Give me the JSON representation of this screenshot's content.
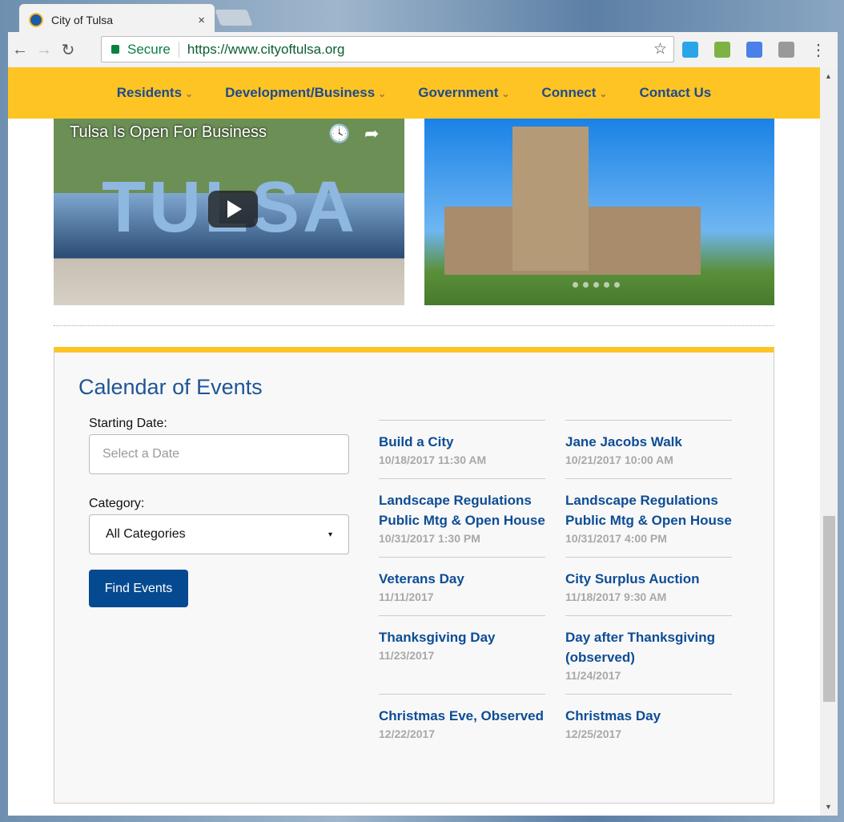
{
  "browser": {
    "tab_title": "City of Tulsa",
    "close": "×",
    "secure_label": "Secure",
    "url": "https://www.cityoftulsa.org",
    "back": "←",
    "forward": "→",
    "reload": "↻",
    "star": "☆",
    "menu": "⋮"
  },
  "nav": {
    "items": [
      {
        "label": "Residents",
        "dropdown": true
      },
      {
        "label": "Development/Business",
        "dropdown": true
      },
      {
        "label": "Government",
        "dropdown": true
      },
      {
        "label": "Connect",
        "dropdown": true
      },
      {
        "label": "Contact Us",
        "dropdown": false
      }
    ],
    "chevron": "❯",
    "bg": "#fdc424",
    "text_color": "#1f4a8c"
  },
  "video": {
    "title": "Tulsa Is Open For Business",
    "mural_text": "TULSA",
    "watch_later": "🕓",
    "share": "➦"
  },
  "calendar": {
    "title": "Calendar of Events",
    "starting_date_label": "Starting Date:",
    "date_placeholder": "Select a Date",
    "category_label": "Category:",
    "category_value": "All Categories",
    "caret": "▾",
    "find_button": "Find Events",
    "events": [
      {
        "title": "Build a City",
        "date": "10/18/2017 11:30 AM"
      },
      {
        "title": "Jane Jacobs Walk",
        "date": "10/21/2017 10:00 AM"
      },
      {
        "title": "Landscape Regulations Public Mtg & Open House",
        "date": "10/31/2017 1:30 PM"
      },
      {
        "title": "Landscape Regulations Public Mtg & Open House",
        "date": "10/31/2017 4:00 PM"
      },
      {
        "title": "Veterans Day",
        "date": "11/11/2017"
      },
      {
        "title": "City Surplus Auction",
        "date": "11/18/2017 9:30 AM"
      },
      {
        "title": "Thanksgiving Day",
        "date": "11/23/2017"
      },
      {
        "title": "Day after Thanksgiving (observed)",
        "date": "11/24/2017"
      },
      {
        "title": "Christmas Eve, Observed",
        "date": "12/22/2017"
      },
      {
        "title": "Christmas Day",
        "date": "12/25/2017"
      }
    ]
  }
}
